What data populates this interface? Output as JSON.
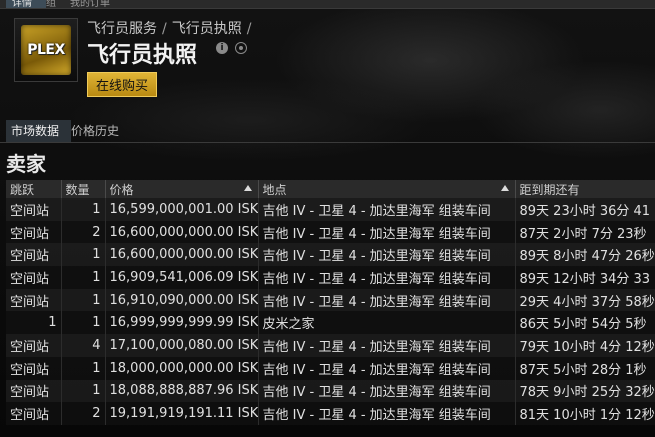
{
  "top_tabs": [
    "详情",
    "组",
    "我的订单"
  ],
  "breadcrumb": {
    "part1": "飞行员服务",
    "part2": "飞行员执照",
    "trail": "/"
  },
  "item": {
    "icon_text": "PLEX",
    "title": "飞行员执照",
    "info": "i"
  },
  "buy_button": "在线购买",
  "subtabs": {
    "market_data": "市场数据",
    "price_history": "价格历史"
  },
  "section_title": "卖家",
  "columns": {
    "jumps": "跳跃",
    "quantity": "数量",
    "price": "价格",
    "location": "地点",
    "expires": "距到期还有"
  },
  "rows": [
    {
      "jumps": "空间站",
      "quantity": "1",
      "price": "16,599,000,001.00 ISK",
      "location": "吉他 IV - 卫星 4 - 加达里海军 组装车间",
      "expires": "89天 23小时 36分 41"
    },
    {
      "jumps": "空间站",
      "quantity": "2",
      "price": "16,600,000,000.00 ISK",
      "location": "吉他 IV - 卫星 4 - 加达里海军 组装车间",
      "expires": "87天 2小时 7分 23秒"
    },
    {
      "jumps": "空间站",
      "quantity": "1",
      "price": "16,600,000,000.00 ISK",
      "location": "吉他 IV - 卫星 4 - 加达里海军 组装车间",
      "expires": "89天 8小时 47分 26秒"
    },
    {
      "jumps": "空间站",
      "quantity": "1",
      "price": "16,909,541,006.09 ISK",
      "location": "吉他 IV - 卫星 4 - 加达里海军 组装车间",
      "expires": "89天 12小时 34分 33"
    },
    {
      "jumps": "空间站",
      "quantity": "1",
      "price": "16,910,090,000.00 ISK",
      "location": "吉他 IV - 卫星 4 - 加达里海军 组装车间",
      "expires": "29天 4小时 37分 58秒"
    },
    {
      "jumps": "1",
      "quantity": "1",
      "price": "16,999,999,999.99 ISK",
      "location": "皮米之家",
      "expires": "86天 5小时 54分 5秒"
    },
    {
      "jumps": "空间站",
      "quantity": "4",
      "price": "17,100,000,080.00 ISK",
      "location": "吉他 IV - 卫星 4 - 加达里海军 组装车间",
      "expires": "79天 10小时 4分 12秒"
    },
    {
      "jumps": "空间站",
      "quantity": "1",
      "price": "18,000,000,000.00 ISK",
      "location": "吉他 IV - 卫星 4 - 加达里海军 组装车间",
      "expires": "87天 5小时 28分 1秒"
    },
    {
      "jumps": "空间站",
      "quantity": "1",
      "price": "18,088,888,887.96 ISK",
      "location": "吉他 IV - 卫星 4 - 加达里海军 组装车间",
      "expires": "78天 9小时 25分 32秒"
    },
    {
      "jumps": "空间站",
      "quantity": "2",
      "price": "19,191,919,191.11 ISK",
      "location": "吉他 IV - 卫星 4 - 加达里海军 组装车间",
      "expires": "81天 10小时 1分 12秒"
    }
  ]
}
